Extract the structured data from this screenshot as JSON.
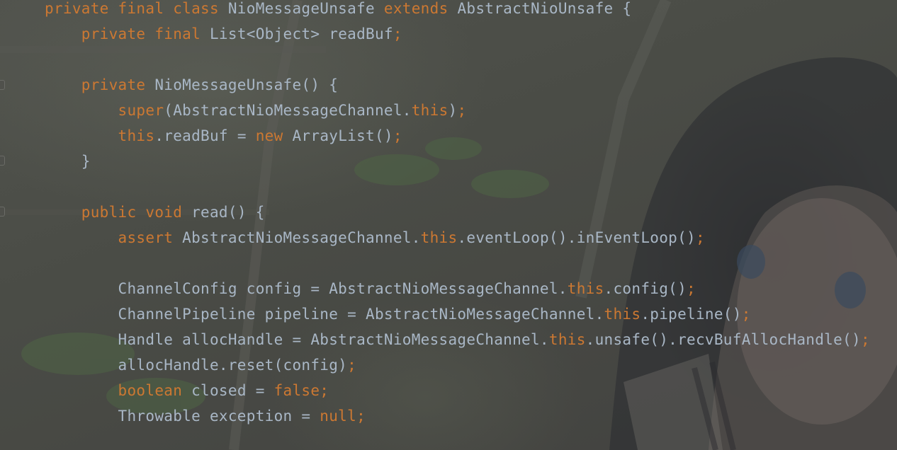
{
  "editor": {
    "theme_colors": {
      "keyword": "#cc7832",
      "text": "#a9b7c6",
      "background": "#4a4b47"
    },
    "lines": [
      [
        {
          "t": "private final class",
          "k": "kw"
        },
        {
          "t": " NioMessageUnsafe ",
          "k": "plain"
        },
        {
          "t": "extends",
          "k": "kw"
        },
        {
          "t": " AbstractNioUnsafe {",
          "k": "plain"
        }
      ],
      [
        {
          "t": "    private final",
          "k": "kw"
        },
        {
          "t": " List<Object> readBuf",
          "k": "plain"
        },
        {
          "t": ";",
          "k": "kw"
        }
      ],
      [],
      [
        {
          "t": "    private",
          "k": "kw"
        },
        {
          "t": " NioMessageUnsafe() {",
          "k": "plain"
        }
      ],
      [
        {
          "t": "        super",
          "k": "kw"
        },
        {
          "t": "(AbstractNioMessageChannel.",
          "k": "plain"
        },
        {
          "t": "this",
          "k": "kw"
        },
        {
          "t": ")",
          "k": "plain"
        },
        {
          "t": ";",
          "k": "kw"
        }
      ],
      [
        {
          "t": "        this",
          "k": "kw"
        },
        {
          "t": ".readBuf = ",
          "k": "plain"
        },
        {
          "t": "new",
          "k": "kw"
        },
        {
          "t": " ArrayList()",
          "k": "plain"
        },
        {
          "t": ";",
          "k": "kw"
        }
      ],
      [
        {
          "t": "    }",
          "k": "plain"
        }
      ],
      [],
      [
        {
          "t": "    public void",
          "k": "kw"
        },
        {
          "t": " read() {",
          "k": "plain"
        }
      ],
      [
        {
          "t": "        assert",
          "k": "kw"
        },
        {
          "t": " AbstractNioMessageChannel.",
          "k": "plain"
        },
        {
          "t": "this",
          "k": "kw"
        },
        {
          "t": ".eventLoop().inEventLoop()",
          "k": "plain"
        },
        {
          "t": ";",
          "k": "kw"
        }
      ],
      [],
      [
        {
          "t": "        ChannelConfig config = AbstractNioMessageChannel.",
          "k": "plain"
        },
        {
          "t": "this",
          "k": "kw"
        },
        {
          "t": ".config()",
          "k": "plain"
        },
        {
          "t": ";",
          "k": "kw"
        }
      ],
      [
        {
          "t": "        ChannelPipeline pipeline = AbstractNioMessageChannel.",
          "k": "plain"
        },
        {
          "t": "this",
          "k": "kw"
        },
        {
          "t": ".pipeline()",
          "k": "plain"
        },
        {
          "t": ";",
          "k": "kw"
        }
      ],
      [
        {
          "t": "        Handle allocHandle = AbstractNioMessageChannel.",
          "k": "plain"
        },
        {
          "t": "this",
          "k": "kw"
        },
        {
          "t": ".unsafe().recvBufAllocHandle()",
          "k": "plain"
        },
        {
          "t": ";",
          "k": "kw"
        }
      ],
      [
        {
          "t": "        allocHandle.reset(config)",
          "k": "plain"
        },
        {
          "t": ";",
          "k": "kw"
        }
      ],
      [
        {
          "t": "        boolean",
          "k": "kw"
        },
        {
          "t": " closed = ",
          "k": "plain"
        },
        {
          "t": "false;",
          "k": "kw"
        }
      ],
      [
        {
          "t": "        Throwable exception = ",
          "k": "plain"
        },
        {
          "t": "null;",
          "k": "kw"
        }
      ]
    ]
  }
}
